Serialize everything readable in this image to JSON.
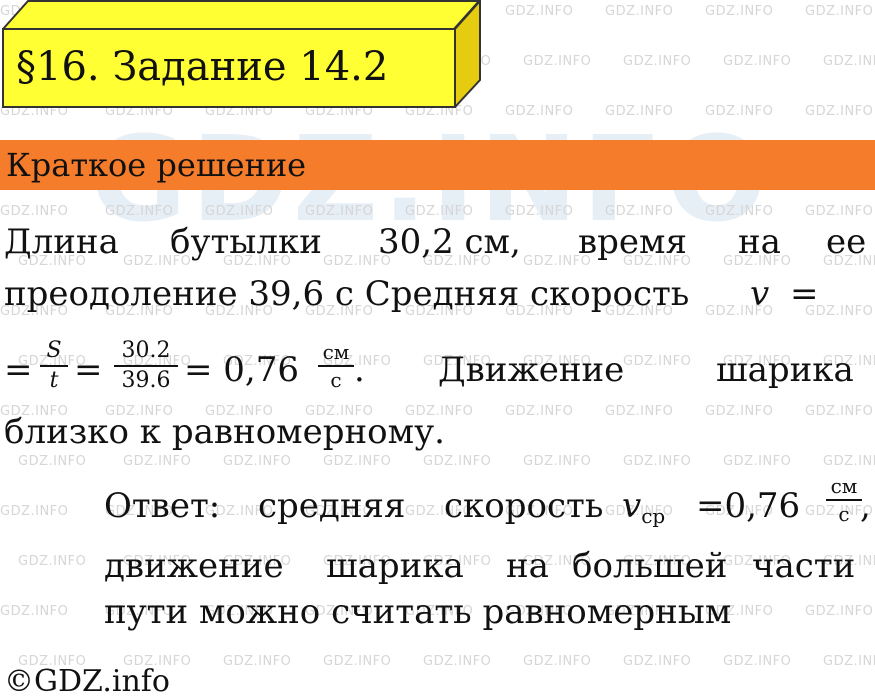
{
  "watermark": {
    "text": "GDZ.INFO",
    "logo": "GDZ.INFO"
  },
  "title": "§16. Задание 14.2",
  "section_label": "Краткое решение",
  "solution": {
    "line1": {
      "w1": "Длина",
      "w2": "бутылки",
      "w3": "30,2 см,",
      "w4": "время",
      "w5": "на",
      "w6": "ее"
    },
    "line2": {
      "text": "преодоление 39,6 с Средняя скорость",
      "var": "v",
      "eq": "="
    },
    "line3": {
      "eq1": "=",
      "frac1_num": "S",
      "frac1_den": "t",
      "eq2": "=",
      "frac2_num": "30.2",
      "frac2_den": "39.6",
      "eq3": "= 0,76",
      "unit_num": "см",
      "unit_den": "с",
      "dot": ".",
      "w1": "Движение",
      "w2": "шарика"
    },
    "line4": "близко к равномерному."
  },
  "answer": {
    "line1": {
      "w1": "Ответ:",
      "w2": "средняя",
      "w3": "скорость",
      "var": "v",
      "sub": "ср",
      "value": "=0,76",
      "unit_num": "см",
      "unit_den": "с",
      "comma": ","
    },
    "line2": {
      "w1": "движение",
      "w2": "шарика",
      "w3": "на",
      "w4": "большей",
      "w5": "части"
    },
    "line3": "пути можно считать равномерным"
  },
  "footer": "©GDZ.info"
}
